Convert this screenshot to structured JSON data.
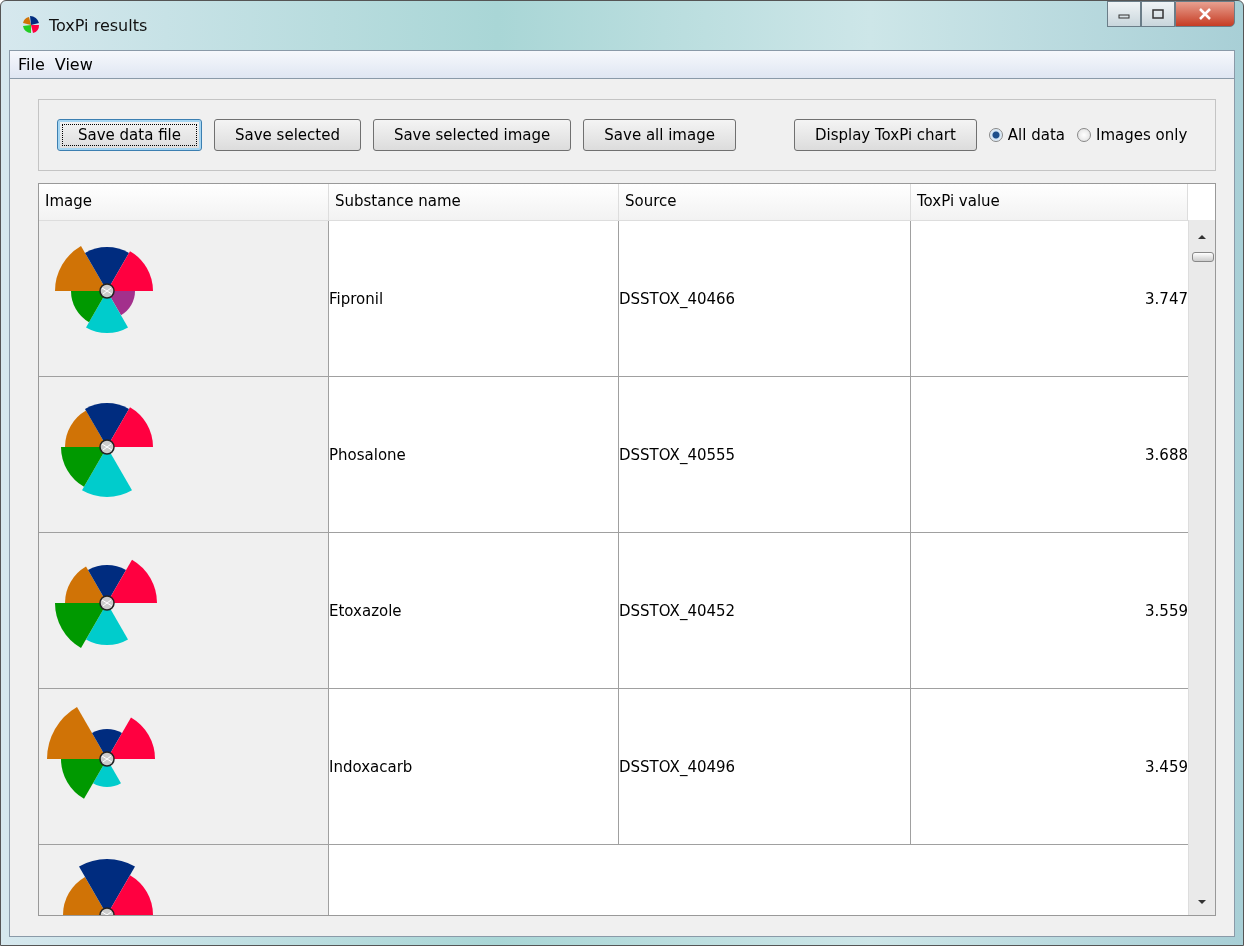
{
  "window": {
    "title": "ToxPi results"
  },
  "menu": [
    "File",
    "View"
  ],
  "toolbar": {
    "buttons": [
      {
        "label": "Save data file",
        "focused": true
      },
      {
        "label": "Save selected",
        "focused": false
      },
      {
        "label": "Save selected image",
        "focused": false
      },
      {
        "label": "Save all image",
        "focused": false
      },
      {
        "label": "Display ToxPi chart",
        "focused": false
      }
    ],
    "radios": [
      {
        "label": "All data",
        "selected": true
      },
      {
        "label": "Images only",
        "selected": false
      }
    ]
  },
  "table": {
    "columns": [
      "Image",
      "Substance name",
      "Source",
      "ToxPi value"
    ],
    "rows": [
      {
        "substance": "Fipronil",
        "source": "DSSTOX_40466",
        "value": "3.747",
        "cut_off": false
      },
      {
        "substance": "Phosalone",
        "source": "DSSTOX_40555",
        "value": "3.688",
        "cut_off": false
      },
      {
        "substance": "Etoxazole",
        "source": "DSSTOX_40452",
        "value": "3.559",
        "cut_off": false
      },
      {
        "substance": "Indoxacarb",
        "source": "DSSTOX_40496",
        "value": "3.459",
        "cut_off": false
      },
      {
        "cut_off": true
      }
    ]
  }
}
